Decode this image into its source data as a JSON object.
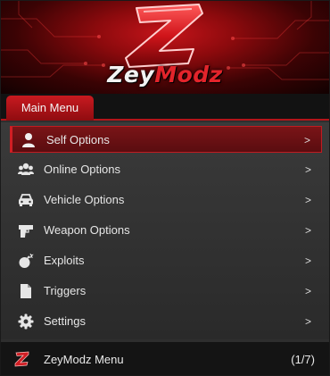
{
  "brand": {
    "logo_text_white": "Zey",
    "logo_text_red": "Modz",
    "accent_color": "#c81a20"
  },
  "tabs": [
    {
      "label": "Main Menu",
      "active": true
    }
  ],
  "items": [
    {
      "label": "Self Options",
      "icon": "user-icon",
      "arrow": ">",
      "selected": true
    },
    {
      "label": "Online Options",
      "icon": "users-icon",
      "arrow": ">"
    },
    {
      "label": "Vehicle Options",
      "icon": "car-icon",
      "arrow": ">"
    },
    {
      "label": "Weapon Options",
      "icon": "gun-icon",
      "arrow": ">"
    },
    {
      "label": "Exploits",
      "icon": "bomb-icon",
      "arrow": ">"
    },
    {
      "label": "Triggers",
      "icon": "file-icon",
      "arrow": ">"
    },
    {
      "label": "Settings",
      "icon": "gear-icon",
      "arrow": ">"
    }
  ],
  "footer": {
    "title": "ZeyModz Menu",
    "counter": "(1/7)"
  }
}
